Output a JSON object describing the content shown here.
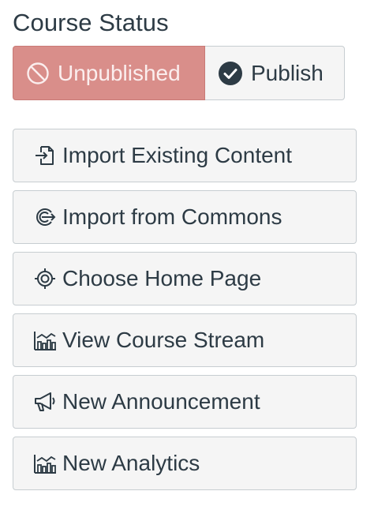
{
  "heading": "Course Status",
  "status": {
    "unpublished_label": "Unpublished",
    "publish_label": "Publish",
    "unpublished_color": "#d98e8a"
  },
  "actions": [
    {
      "label": "Import Existing Content",
      "icon": "import-icon"
    },
    {
      "label": "Import from Commons",
      "icon": "commons-icon"
    },
    {
      "label": "Choose Home Page",
      "icon": "target-icon"
    },
    {
      "label": "View Course Stream",
      "icon": "analytics-icon"
    },
    {
      "label": "New Announcement",
      "icon": "megaphone-icon"
    },
    {
      "label": "New Analytics",
      "icon": "analytics-icon"
    }
  ]
}
